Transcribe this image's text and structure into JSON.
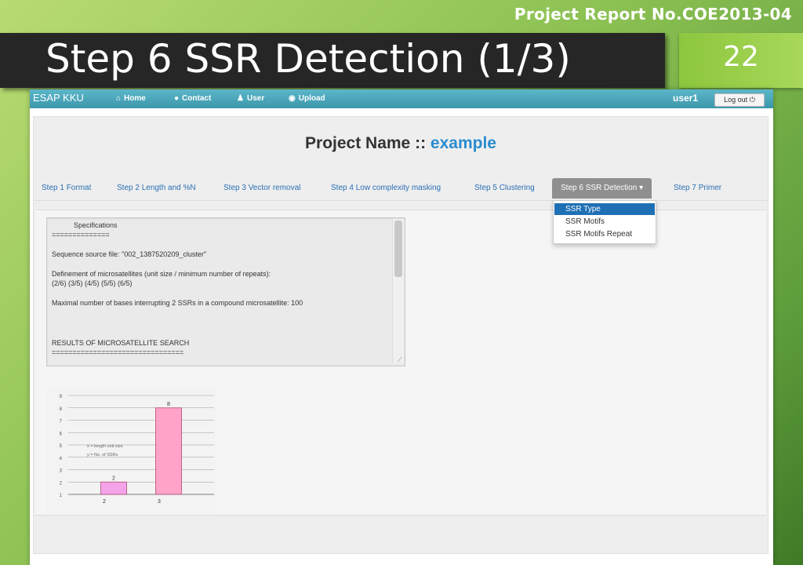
{
  "slide": {
    "report_no": "Project Report No.COE2013-04",
    "title": "Step 6 SSR Detection (1/3)",
    "page_number": "22"
  },
  "navbar": {
    "brand": "ESAP KKU",
    "items": [
      {
        "label": "Home",
        "icon": "home-icon"
      },
      {
        "label": "Contact",
        "icon": "info-icon"
      },
      {
        "label": "User",
        "icon": "user-icon"
      },
      {
        "label": "Upload",
        "icon": "upload-icon"
      }
    ],
    "user": "user1",
    "logout_label": "Log out"
  },
  "project": {
    "prefix": "Project Name :: ",
    "name": "example"
  },
  "tabs": [
    "Step 1 Format",
    "Step 2 Length and %N",
    "Step 3 Vector removal",
    "Step 4 Low complexity masking",
    "Step 5 Clustering",
    "Step 6 SSR Detection",
    "Step 7 Primer"
  ],
  "active_tab": "Step 6 SSR Detection",
  "dropdown": {
    "items": [
      "SSR Type",
      "SSR Motifs",
      "SSR Motifs Repeat"
    ],
    "selected": "SSR Type"
  },
  "spec_text": {
    "heading": "Specifications",
    "rule1": "==============",
    "source": "Sequence source file: \"002_1387520209_cluster\"",
    "definement": "Definement of microsatellites (unit size / minimum number of repeats):",
    "units": "(2/6) (3/5) (4/5) (5/5) (6/5)",
    "maximal": "Maximal number of bases interrupting 2 SSRs in a compound microsatellite:  100",
    "results": "RESULTS OF MICROSATELLITE SEARCH",
    "rule2": "================================"
  },
  "chart_data": {
    "type": "bar",
    "categories": [
      "2",
      "3"
    ],
    "values": [
      2,
      8
    ],
    "data_labels": [
      "2",
      "8"
    ],
    "y_ticks": [
      "1",
      "2",
      "3",
      "4",
      "5",
      "6",
      "7",
      "8",
      "9"
    ],
    "ylim": [
      1,
      9
    ],
    "annotations": [
      "x = length unit size",
      "y = No. of SSRs"
    ],
    "colors": {
      "bar1": "#f5a3e8",
      "bar2": "#ffa3c8"
    },
    "grid": true
  }
}
